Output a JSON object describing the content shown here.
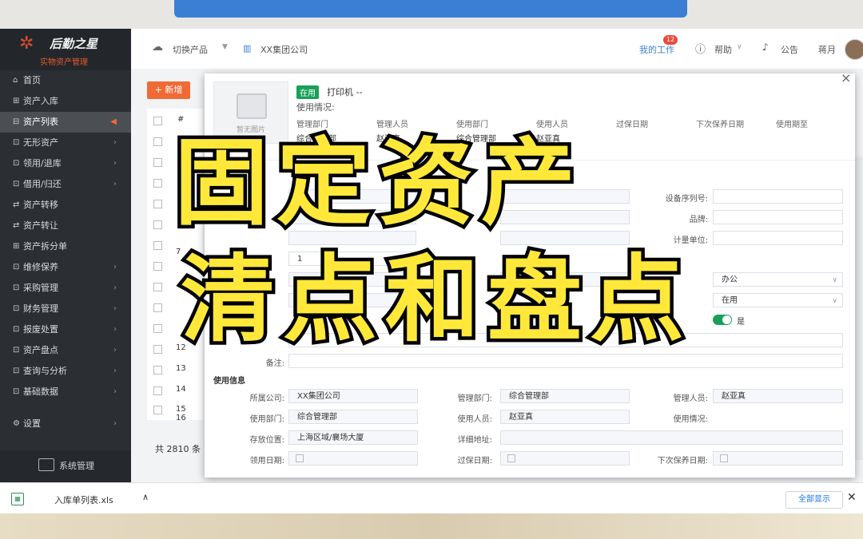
{
  "brand": {
    "title": "后勤之星",
    "subtitle": "实物资产管理"
  },
  "header": {
    "switch_product": "切换产品",
    "company": "XX集团公司",
    "my_work": "我的工作",
    "my_work_badge": "12",
    "help": "帮助",
    "notice": "公告",
    "user": "蒋月"
  },
  "sidebar": {
    "items": [
      {
        "label": "首页",
        "icon": "home-icon"
      },
      {
        "label": "资产入库",
        "icon": "grid-icon"
      },
      {
        "label": "资产列表",
        "icon": "list-icon",
        "active": true
      },
      {
        "label": "无形资产",
        "icon": "grid-icon"
      },
      {
        "label": "领用/退库",
        "icon": "grid-icon"
      },
      {
        "label": "借用/归还",
        "icon": "grid-icon"
      },
      {
        "label": "资产转移",
        "icon": "transfer-icon"
      },
      {
        "label": "资产转让",
        "icon": "transfer-icon"
      },
      {
        "label": "资产拆分单",
        "icon": "grid-icon"
      },
      {
        "label": "维修保养",
        "icon": "grid-icon"
      },
      {
        "label": "采购管理",
        "icon": "grid-icon"
      },
      {
        "label": "财务管理",
        "icon": "grid-icon"
      },
      {
        "label": "报废处置",
        "icon": "grid-icon"
      },
      {
        "label": "资产盘点",
        "icon": "grid-icon"
      },
      {
        "label": "查询与分析",
        "icon": "grid-icon"
      },
      {
        "label": "基础数据",
        "icon": "grid-icon"
      },
      {
        "label": "设置",
        "icon": "gear-icon"
      }
    ],
    "system_management": "系统管理"
  },
  "toolbar": {
    "add_label": "新增",
    "table_header_num": "#"
  },
  "table": {
    "row_numbers": [
      "7",
      "12",
      "13",
      "14",
      "15",
      "16"
    ]
  },
  "pager": {
    "total": "共 2810 条"
  },
  "modal": {
    "no_image": "暂无图片",
    "status_tag": "在用",
    "asset_name": "打印机",
    "asset_name_suffix": "--",
    "usage_title": "使用情况:",
    "info_headers": [
      "管理部门",
      "管理人员",
      "使用部门",
      "使用人员",
      "过保日期",
      "下次保养日期",
      "使用期至"
    ],
    "info_values": [
      "综合管理部",
      "赵亚真",
      "综合管理部",
      "赵亚真"
    ],
    "fields": {
      "device_serial_label": "设备序列号:",
      "brand_label": "品牌:",
      "unit_label": "计量单位:",
      "quantity_value": "1",
      "purpose_value": "办公",
      "status_value": "在用",
      "toggle_value": "是",
      "remark_label": "备注:"
    },
    "usage_section": {
      "title": "使用信息",
      "company_label": "所属公司:",
      "company_value": "XX集团公司",
      "mgmt_dept_label": "管理部门:",
      "mgmt_dept_value": "综合管理部",
      "manager_label": "管理人员:",
      "manager_value": "赵亚真",
      "use_dept_label": "使用部门:",
      "use_dept_value": "综合管理部",
      "user_label": "使用人员:",
      "user_value": "赵亚真",
      "usage_label": "使用情况:",
      "location_label": "存放位置:",
      "location_value": "上海区域/襄场大厦",
      "address_label": "详细地址:",
      "receive_date_label": "领用日期:",
      "warranty_date_label": "过保日期:",
      "next_maint_label": "下次保养日期:"
    }
  },
  "download_bar": {
    "file_name": "入库单列表.xls",
    "show_all": "全部显示"
  },
  "overlay": {
    "line1": "固定资产",
    "line2": "清点和盘点"
  },
  "colors": {
    "accent": "#f06a35",
    "sidebar": "#2b2f33",
    "success": "#18a058",
    "overlay_text": "#ffe83a"
  }
}
